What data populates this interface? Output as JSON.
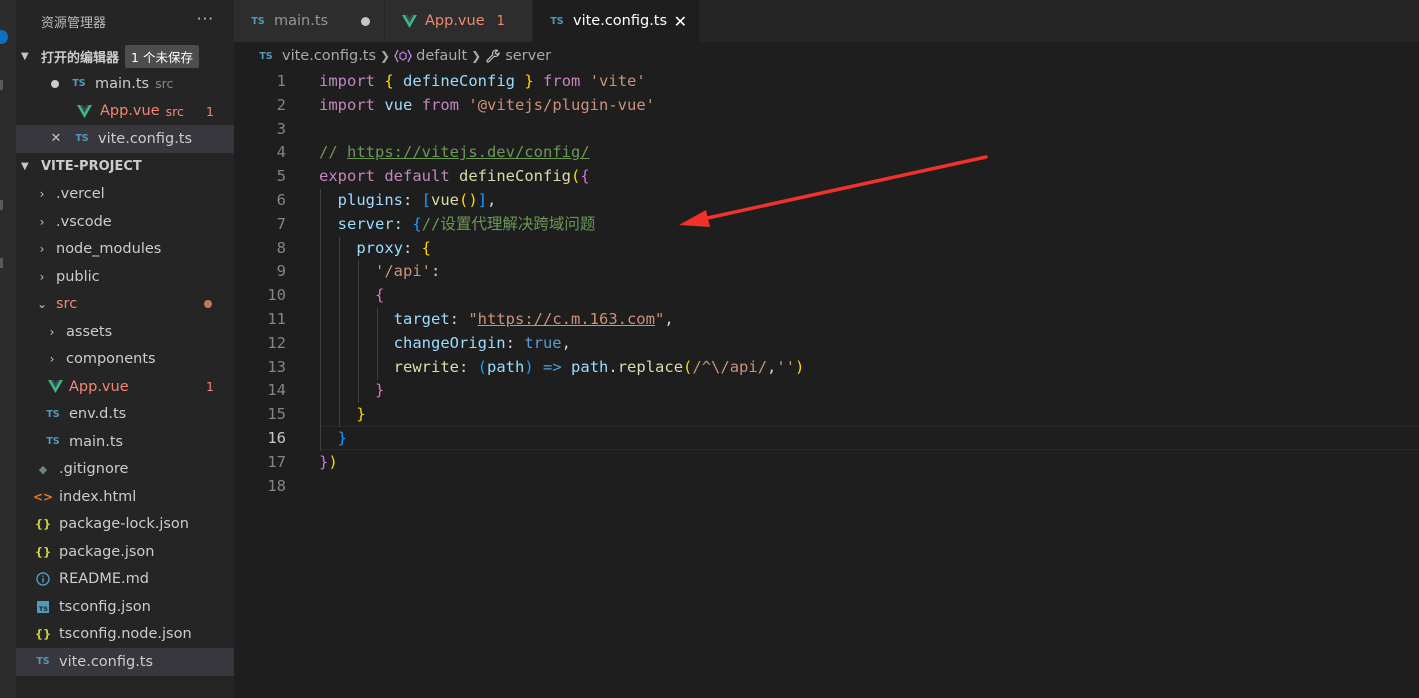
{
  "sidebar": {
    "title": "资源管理器",
    "more": "···",
    "open_editors": {
      "label": "打开的编辑器",
      "unsaved": "1 个未保存",
      "items": [
        {
          "icon": "ts",
          "name": "main.ts",
          "desc": "src"
        },
        {
          "icon": "vue",
          "name": "App.vue",
          "desc": "src",
          "problems": "1"
        },
        {
          "icon": "ts",
          "name": "vite.config.ts"
        }
      ]
    },
    "project": {
      "label": "VITE-PROJECT",
      "items": [
        {
          "name": ".vercel"
        },
        {
          "name": ".vscode"
        },
        {
          "name": "node_modules"
        },
        {
          "name": "public"
        },
        {
          "name": "src"
        },
        {
          "name": "assets"
        },
        {
          "name": "components"
        },
        {
          "name": "App.vue",
          "problems": "1"
        },
        {
          "name": "env.d.ts"
        },
        {
          "name": "main.ts"
        },
        {
          "name": ".gitignore"
        },
        {
          "name": "index.html"
        },
        {
          "name": "package-lock.json"
        },
        {
          "name": "package.json"
        },
        {
          "name": "README.md"
        },
        {
          "name": "tsconfig.json"
        },
        {
          "name": "tsconfig.node.json"
        },
        {
          "name": "vite.config.ts"
        }
      ]
    }
  },
  "icons": {
    "ts": "TS",
    "tsbox": "TS",
    "html": "<>",
    "json": "{}",
    "git": "◆",
    "close": "✕"
  },
  "tabs": [
    {
      "name": "main.ts",
      "icon": "ts",
      "state": "modified"
    },
    {
      "name": "App.vue",
      "icon": "vue",
      "problems": "1"
    },
    {
      "name": "vite.config.ts",
      "icon": "ts",
      "active": true
    }
  ],
  "breadcrumb": {
    "file": "vite.config.ts",
    "symbol1": "default",
    "symbol2": "server"
  },
  "editor": {
    "current_line": 16,
    "line_numbers": [
      "1",
      "2",
      "3",
      "4",
      "5",
      "6",
      "7",
      "8",
      "9",
      "10",
      "11",
      "12",
      "13",
      "14",
      "15",
      "16",
      "17",
      "18"
    ],
    "tokens": {
      "import": "import",
      "from": "from",
      "export": "export",
      "default": "default",
      "defineConfig": "defineConfig",
      "vue": "vue",
      "vite_str": "'vite'",
      "plugin_str": "'@vitejs/plugin-vue'",
      "comment_prefix": "// ",
      "comment_url": "https://vitejs.dev/config/",
      "plugins": "plugins",
      "server": "server",
      "server_comment": "//设置代理解决跨域问题",
      "proxy": "proxy",
      "api_key": "'/api'",
      "target": "target",
      "target_q1": "\"",
      "target_url": "https://c.m.163.com",
      "target_q2": "\"",
      "changeOrigin": "changeOrigin",
      "true": "true",
      "rewrite": "rewrite",
      "path": "path",
      "arrow": "=>",
      "replace": "replace",
      "regex": "/^\\/api/",
      "empty_str": "''"
    }
  }
}
